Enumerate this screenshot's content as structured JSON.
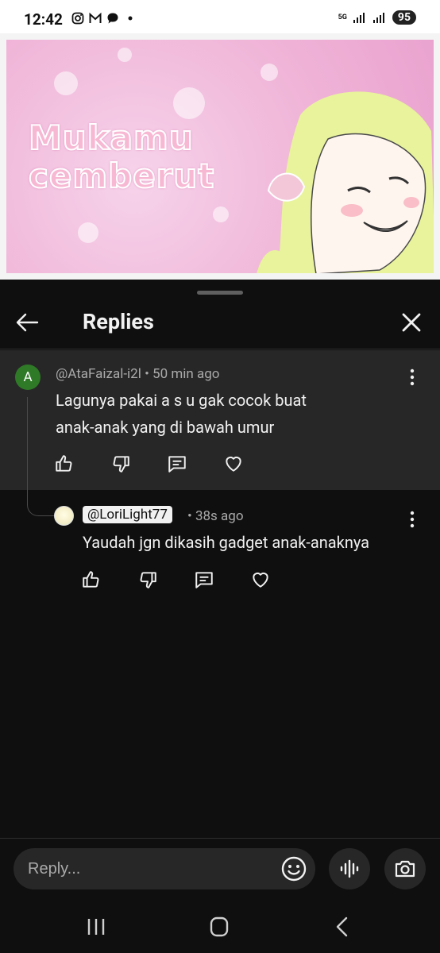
{
  "status_bar": {
    "time": "12:42",
    "network": "5G",
    "battery": "95",
    "left_icons": [
      "instagram-icon",
      "gmail-icon",
      "chat-icon",
      "dot-icon"
    ],
    "right_icons": [
      "signal-icon",
      "signal-icon"
    ]
  },
  "video": {
    "title_line1": "Mukamu",
    "title_line2": "cemberut"
  },
  "header": {
    "title": "Replies"
  },
  "parent_comment": {
    "avatar_letter": "A",
    "avatar_color": "#2f7a27",
    "author": "@AtaFaizal-i2l",
    "time": "50 min ago",
    "text_line1": "Lagunya pakai a s u gak cocok buat",
    "text_line2": "anak-anak yang di bawah umur"
  },
  "reply_comment": {
    "mention": "@LoriLight77",
    "time": "38s ago",
    "text": "Yaudah jgn dikasih gadget anak-anaknya"
  },
  "composer": {
    "placeholder": "Reply..."
  },
  "colors": {
    "background": "#0f0f0f",
    "surface": "#272727",
    "text": "#f1f1f1",
    "muted": "#aaaaaa"
  }
}
